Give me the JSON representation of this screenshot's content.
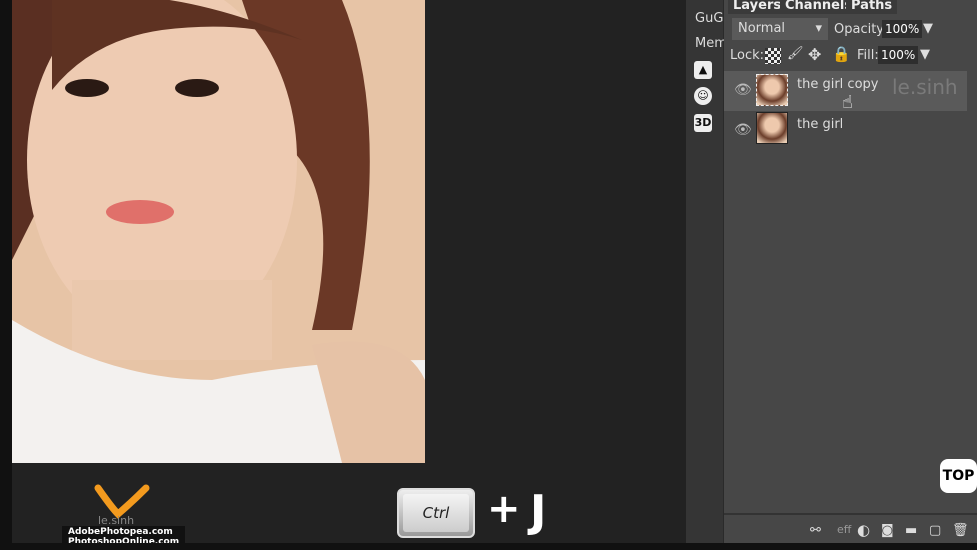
{
  "toolbar": {
    "items": [
      "GuG",
      "Mem"
    ],
    "icons": [
      "image-icon",
      "emoji-icon",
      "3d-icon"
    ],
    "icon_3d": "3D"
  },
  "panel": {
    "tabs": [
      "Layers",
      "Channels",
      "Paths"
    ],
    "blend_mode": "Normal",
    "opacity_label": "Opacity:",
    "opacity": "100%",
    "lock_label": "Lock:",
    "fill_label": "Fill:",
    "fill": "100%",
    "layers": [
      {
        "name": "the girl copy",
        "selected": true
      },
      {
        "name": "the girl",
        "selected": false
      }
    ],
    "footer_icons": [
      "link-icon",
      "effects-icon",
      "adjustment-icon",
      "mask-icon",
      "folder-icon",
      "new-layer-icon",
      "trash-icon"
    ],
    "effects_label": "eff"
  },
  "overlay": {
    "top_button": "TOP",
    "key1": "Ctrl",
    "plus": "+",
    "key2": "J",
    "watermark": "le.sinh",
    "sites": [
      "AdobePhotopea.com",
      "PhotoshopOnline.com"
    ]
  },
  "colors": {
    "panel_bg": "#474747",
    "logo_orange": "#f39a1e"
  }
}
